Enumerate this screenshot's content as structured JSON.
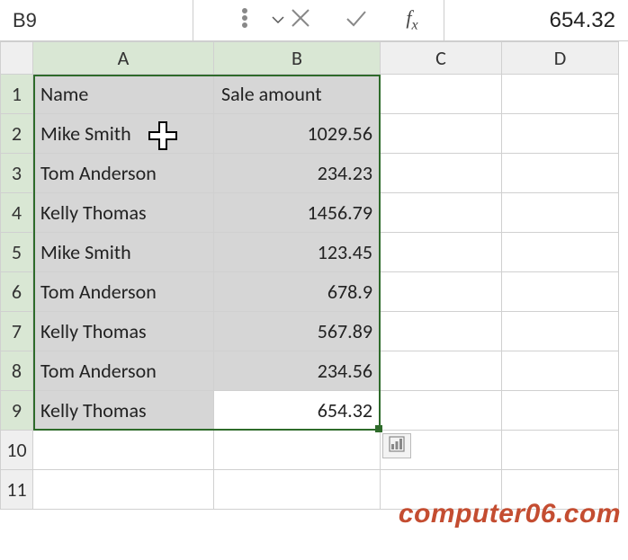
{
  "formula_bar": {
    "name_box": "B9",
    "formula_value": "654.32"
  },
  "columns": [
    "A",
    "B",
    "C",
    "D"
  ],
  "rows": [
    "1",
    "2",
    "3",
    "4",
    "5",
    "6",
    "7",
    "8",
    "9",
    "10",
    "11"
  ],
  "sheet": {
    "header": {
      "A": "Name",
      "B": "Sale amount"
    },
    "data": [
      {
        "A": "Mike Smith",
        "B": "1029.56"
      },
      {
        "A": "Tom Anderson",
        "B": "234.23"
      },
      {
        "A": "Kelly Thomas",
        "B": "1456.79"
      },
      {
        "A": "Mike Smith",
        "B": "123.45"
      },
      {
        "A": "Tom Anderson",
        "B": "678.9"
      },
      {
        "A": "Kelly Thomas",
        "B": "567.89"
      },
      {
        "A": "Tom Anderson",
        "B": "234.56"
      },
      {
        "A": "Kelly Thomas",
        "B": "654.32"
      }
    ]
  },
  "watermark": "computer06.com",
  "colors": {
    "selection_border": "#2e6b2a",
    "selection_fill": "#d6d6d6",
    "header_highlight": "#d9e7d4",
    "watermark": "#c44d31"
  }
}
